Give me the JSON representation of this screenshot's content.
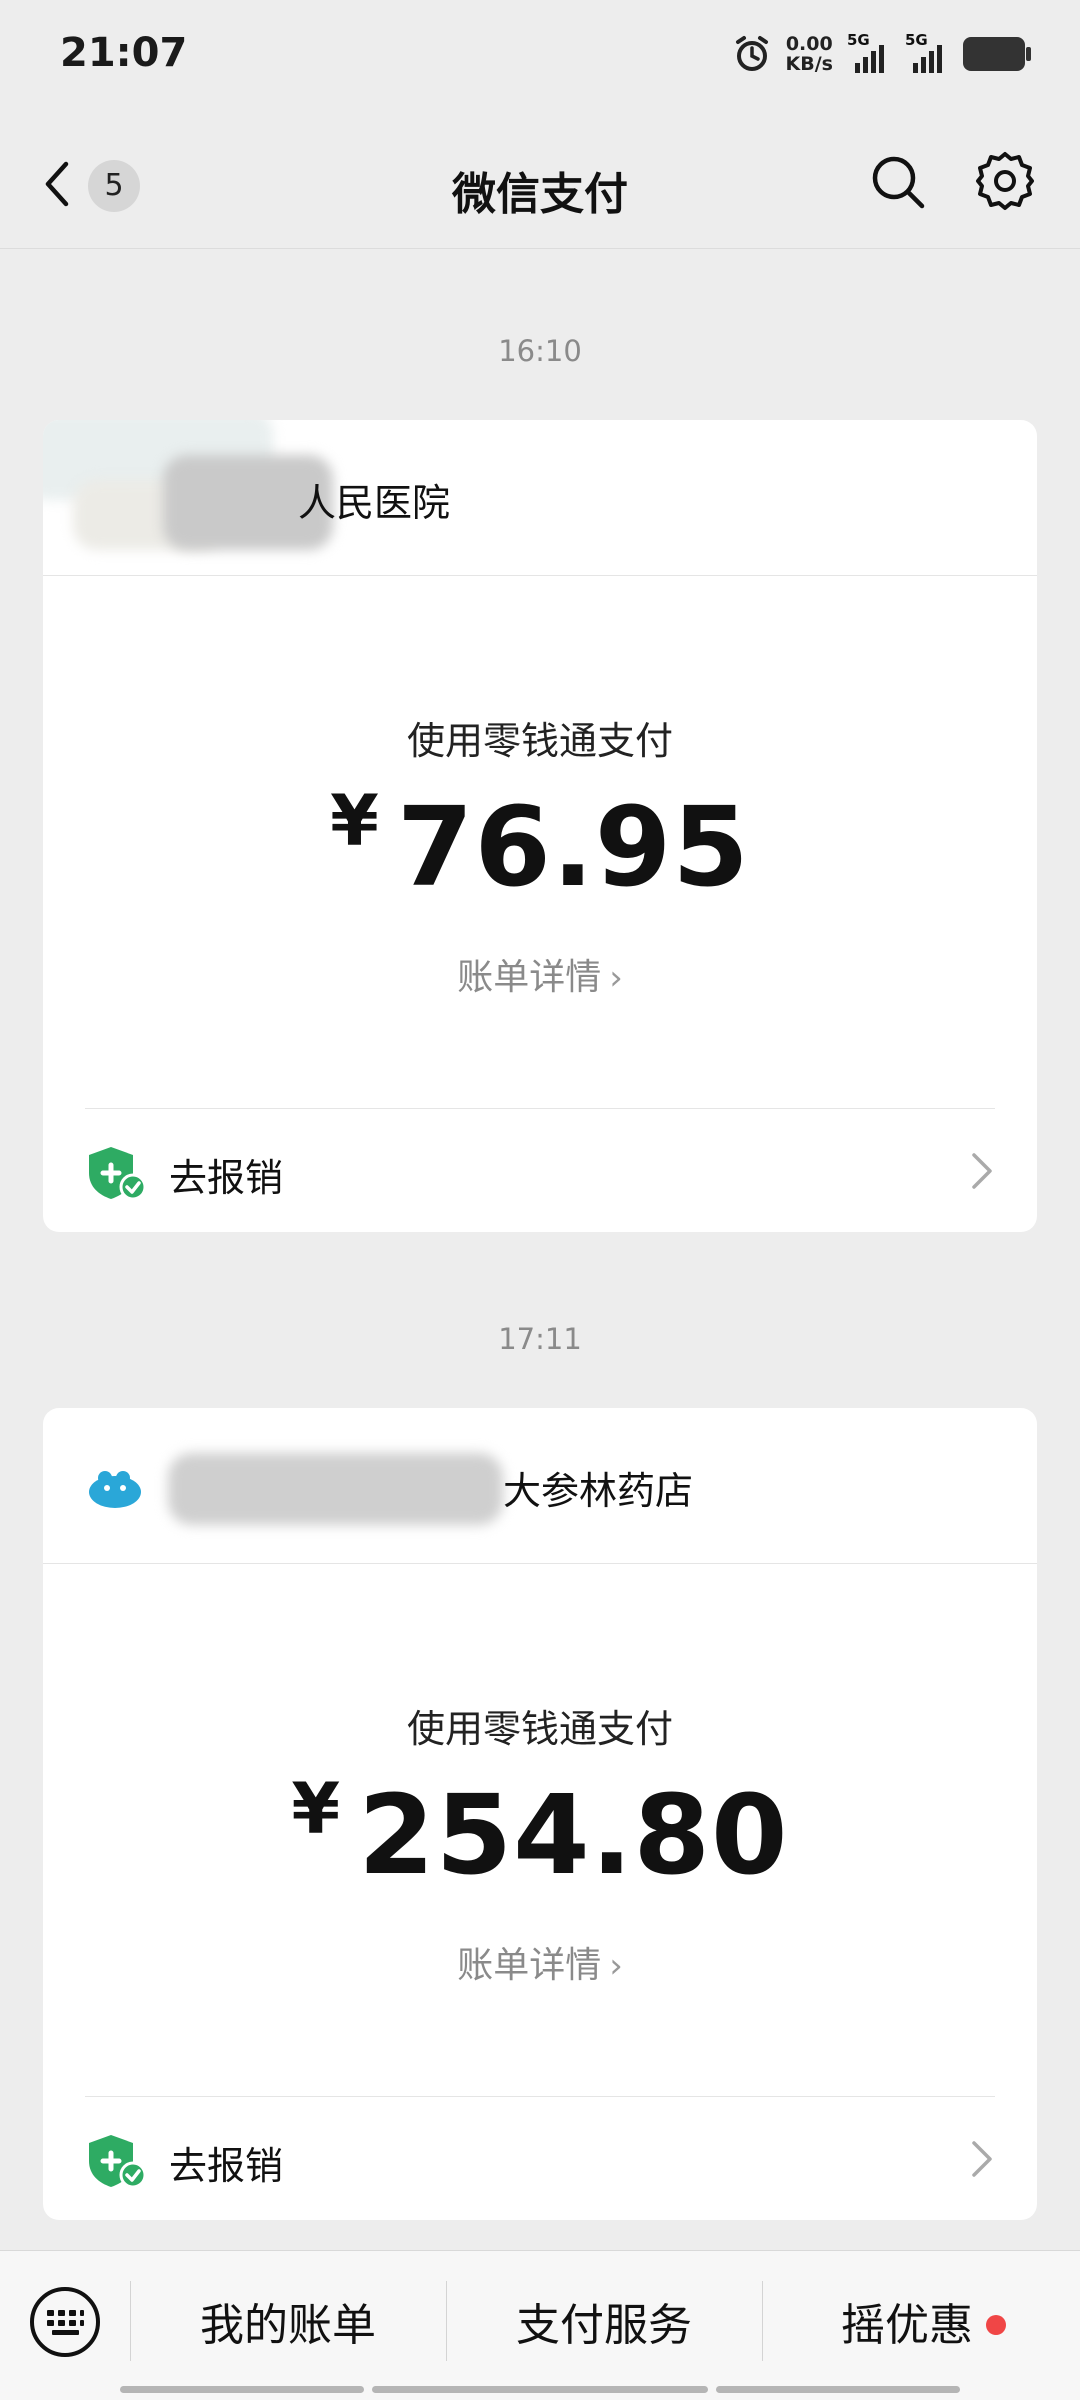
{
  "status_bar": {
    "time": "21:07",
    "net_speed_value": "0.00",
    "net_speed_unit": "KB/s",
    "sim1_label": "5G",
    "sim2_label": "5G",
    "icons": [
      "alarm-icon",
      "signal-icon",
      "battery-icon"
    ]
  },
  "nav": {
    "back_count": "5",
    "title": "微信支付",
    "icons": [
      "back-icon",
      "search-icon",
      "gear-icon"
    ]
  },
  "messages": [
    {
      "time": "16:10",
      "merchant": "人民医院",
      "pay_method": "使用零钱通支付",
      "currency": "¥",
      "amount": "76.95",
      "details_label": "账单详情",
      "reimburse_label": "去报销"
    },
    {
      "time": "17:11",
      "merchant": "大参林药店",
      "pay_method": "使用零钱通支付",
      "currency": "¥",
      "amount": "254.80",
      "details_label": "账单详情",
      "reimburse_label": "去报销"
    }
  ],
  "bottom_menu": {
    "items": [
      "我的账单",
      "支付服务",
      "摇优惠"
    ],
    "icons": [
      "keyboard-icon"
    ]
  },
  "colors": {
    "background": "#ededed",
    "card": "#ffffff",
    "accent_green": "#28a745",
    "notification_red": "#f04646",
    "muted_text": "#8a8a8a"
  }
}
